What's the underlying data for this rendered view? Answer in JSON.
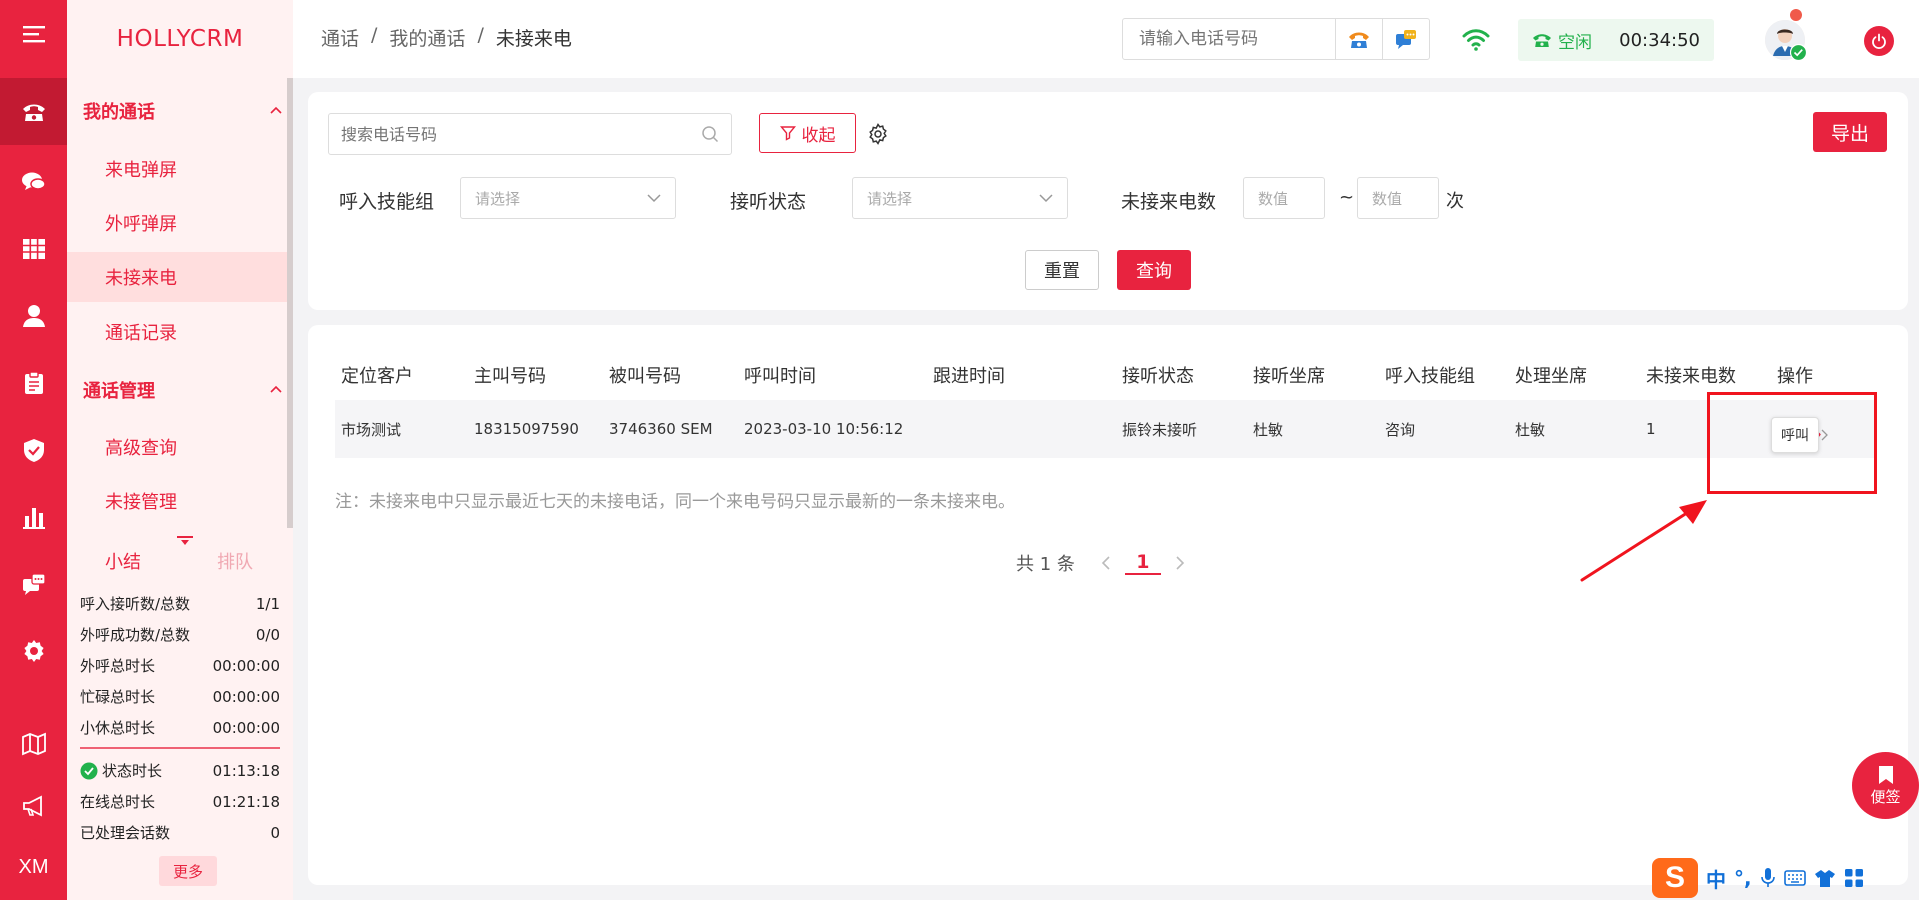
{
  "brand": "HOLLYCRM",
  "rail": {
    "bottom_text": "XM"
  },
  "nav": {
    "groups": [
      {
        "title": "我的通话",
        "items": [
          "来电弹屏",
          "外呼弹屏",
          "未接来电",
          "通话记录"
        ]
      },
      {
        "title": "通话管理",
        "items": [
          "高级查询",
          "未接管理"
        ]
      }
    ],
    "active_item": "未接来电"
  },
  "summary": {
    "tab_active": "小结",
    "tab_inactive": "排队",
    "stats": [
      {
        "label": "呼入接听数/总数",
        "value": "1/1"
      },
      {
        "label": "外呼成功数/总数",
        "value": "0/0"
      },
      {
        "label": "外呼总时长",
        "value": "00:00:00"
      },
      {
        "label": "忙碌总时长",
        "value": "00:00:00"
      },
      {
        "label": "小休总时长",
        "value": "00:00:00"
      }
    ],
    "stats2": [
      {
        "label": "状态时长",
        "value": "01:13:18"
      },
      {
        "label": "在线总时长",
        "value": "01:21:18"
      },
      {
        "label": "已处理会话数",
        "value": "0"
      }
    ],
    "more": "更多"
  },
  "header": {
    "breadcrumb": [
      "通话",
      "我的通话",
      "未接来电"
    ],
    "phone_placeholder": "请输入电话号码",
    "status": "空闲",
    "timer": "00:34:50"
  },
  "filter": {
    "search_placeholder": "搜索电话号码",
    "collapse": "收起",
    "export": "导出",
    "skill_label": "呼入技能组",
    "skill_placeholder": "请选择",
    "answer_label": "接听状态",
    "answer_placeholder": "请选择",
    "missed_label": "未接来电数",
    "num_placeholder": "数值",
    "tilde": "~",
    "unit": "次",
    "reset": "重置",
    "query": "查询"
  },
  "table": {
    "headers": [
      "定位客户",
      "主叫号码",
      "被叫号码",
      "呼叫时间",
      "跟进时间",
      "接听状态",
      "接听坐席",
      "呼入技能组",
      "处理坐席",
      "未接来电数",
      "操作"
    ],
    "rows": [
      [
        "市场测试",
        "18315097590",
        "3746360 SEM",
        "2023-03-10 10:56:12",
        "",
        "振铃未接听",
        "杜敏",
        "咨询",
        "杜敏",
        "1",
        ""
      ]
    ],
    "tooltip": "呼叫",
    "note": "注：未接来电中只显示最近七天的未接电话，同一个来电号码只显示最新的一条未接来电。",
    "total": "共 1 条",
    "page": "1"
  },
  "floating": {
    "memo": "便签"
  },
  "ime": {
    "logo": "S",
    "lang": "中",
    "punct": "°,"
  },
  "colors": {
    "accent": "#e8233f",
    "green": "#22b14c",
    "annotation": "#f0141e"
  }
}
